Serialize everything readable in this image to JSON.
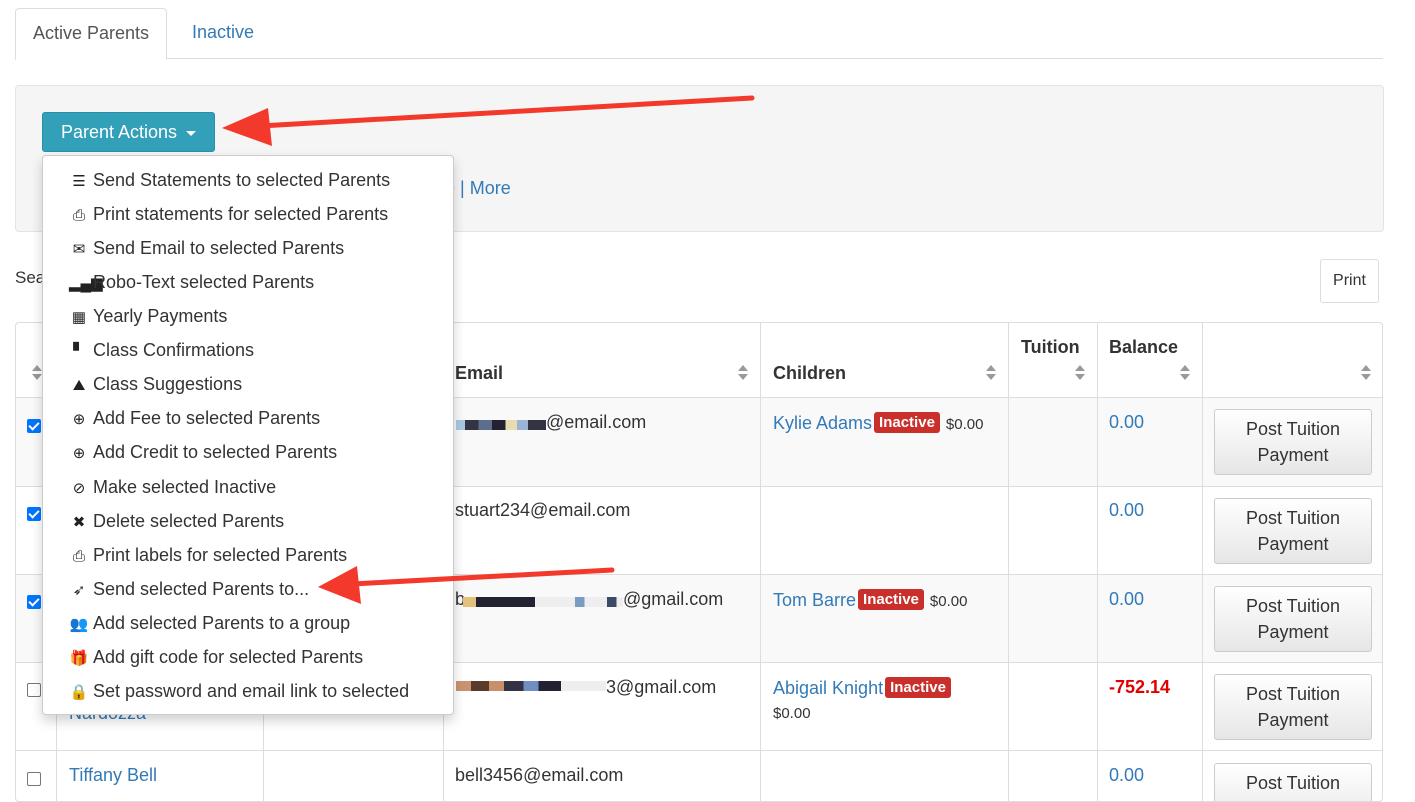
{
  "tabs": [
    {
      "label": "Active Parents"
    },
    {
      "label": "Inactive"
    }
  ],
  "actions_button": {
    "label": "Parent Actions"
  },
  "more_line": {
    "partial": "e | ",
    "more": "More"
  },
  "search_label": "Sea",
  "print_button": "Print",
  "table": {
    "headers": {
      "email": "Email",
      "children": "Children",
      "tuition": "Tuition",
      "balance": "Balance"
    },
    "rows": [
      {
        "email": "@email.com",
        "child": "Kylie Adams",
        "badge": "Inactive",
        "child_amount": "$0.00",
        "balance": "0.00",
        "button": "Post Tuition Payment"
      },
      {
        "email": "stuart234@email.com",
        "child": "",
        "badge": "",
        "child_amount": "",
        "balance": "0.00",
        "button": "Post Tuition Payment"
      },
      {
        "email": "@gmail.com",
        "email_prefix": "b",
        "child": "Tom Barre",
        "badge": "Inactive",
        "child_amount": "$0.00",
        "balance": "0.00",
        "button": "Post Tuition Payment"
      },
      {
        "email": "3@gmail.com",
        "child": "Abigail Knight",
        "badge": "Inactive",
        "child_amount": "$0.00",
        "balance": "-752.14",
        "name_fragment": "Nardozza",
        "button": "Post Tuition Payment"
      },
      {
        "name": "Tiffany Bell",
        "email": "bell3456@email.com",
        "balance": "0.00",
        "button": "Post Tuition"
      }
    ]
  },
  "menu": {
    "items": [
      {
        "label": "Send Statements to selected Parents",
        "icon": "list-icon"
      },
      {
        "label": "Print statements for selected Parents",
        "icon": "print-icon"
      },
      {
        "label": "Send Email to selected Parents",
        "icon": "envelope-icon"
      },
      {
        "label": "Robo-Text selected Parents",
        "icon": "signal-icon"
      },
      {
        "label": "Yearly Payments",
        "icon": "calendar-icon"
      },
      {
        "label": "Class Confirmations",
        "icon": "file-icon"
      },
      {
        "label": "Class Suggestions",
        "icon": "road-icon"
      },
      {
        "label": "Add Fee to selected Parents",
        "icon": "plus-circle-icon"
      },
      {
        "label": "Add Credit to selected Parents",
        "icon": "plus-circle-icon"
      },
      {
        "label": "Make selected Inactive",
        "icon": "ban-icon"
      },
      {
        "label": "Delete selected Parents",
        "icon": "times-icon"
      },
      {
        "label": "Print labels for selected Parents",
        "icon": "print-icon"
      },
      {
        "label": "Send selected Parents to...",
        "icon": "paper-plane-icon"
      },
      {
        "label": "Add selected Parents to a group",
        "icon": "users-icon"
      },
      {
        "label": "Add gift code for selected Parents",
        "icon": "gift-icon"
      },
      {
        "label": "Set password and email link to selected",
        "icon": "lock-icon"
      }
    ]
  },
  "colors": {
    "primary": "#31a0b8",
    "link": "#337ab7",
    "danger": "#c9302c",
    "arrow": "#f2392c"
  }
}
